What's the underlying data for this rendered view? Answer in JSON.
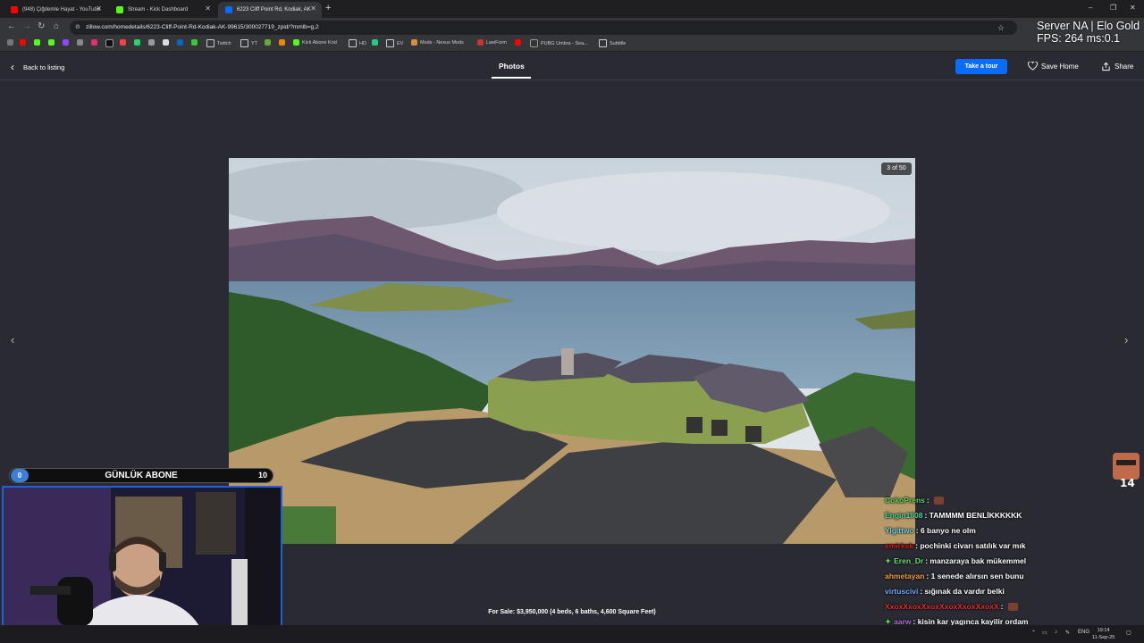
{
  "browser": {
    "tabs": [
      {
        "label": "(948) Çiğdemle Hayat - YouTube",
        "color": "#ff0000"
      },
      {
        "label": "Stream - Kick Dashboard",
        "color": "#53fc18"
      },
      {
        "label": "6223 Cliff Point Rd, Kodiak, AK",
        "color": "#0a6cff"
      }
    ],
    "url": "zillow.com/homedetails/6223-Cliff-Point-Rd-Kodiak-AK-99615/300027719_zpid/?mmlb=g,2",
    "bookmarks": [
      "Twitch",
      "YT",
      "Kick Abone Kod",
      "HD",
      "EV",
      "Mods - Nexus Mods",
      "LawForm",
      "PUBG Umbra - Sea...",
      "Subtitle"
    ]
  },
  "overlay": {
    "server": "Server NA | Elo Gold",
    "fps": "FPS: 264 ms:0.1"
  },
  "zillow": {
    "back_label": "Back to listing",
    "photos_tab": "Photos",
    "tour_label": "Take a tour",
    "save_label": "Save Home",
    "share_label": "Share",
    "photo_counter": "3 of 50",
    "caption": "For Sale: $3,950,000 (4 beds, 6 baths, 4,600 Square Feet)"
  },
  "stream": {
    "sub_goal": {
      "label": "GÜNLÜK ABONE",
      "current": "0",
      "target": "10"
    },
    "chat": [
      {
        "user": "CokoPrens",
        "color": "#5fd860",
        "text": "",
        "emote": true,
        "badge": false
      },
      {
        "user": "Engin1808",
        "color": "#4fd89a",
        "text": "TAMMMM BENLİKKKKKK",
        "emote": false,
        "badge": false
      },
      {
        "user": "Yigittwo",
        "color": "#70d8e8",
        "text": "6 banyo ne olm",
        "emote": false,
        "badge": false
      },
      {
        "user": "emirksk",
        "color": "#d02020",
        "text": "pochinki civarı satılık var mık",
        "emote": false,
        "badge": false
      },
      {
        "user": "Eren_Dr",
        "color": "#70e070",
        "text": "manzaraya bak mükemmel",
        "emote": false,
        "badge": true
      },
      {
        "user": "ahmetayan",
        "color": "#f0a040",
        "text": "1 senede alırsın sen bunu",
        "emote": false,
        "badge": false
      },
      {
        "user": "virtuscivi",
        "color": "#7aa8ff",
        "text": "sığınak da vardır belki",
        "emote": false,
        "badge": false
      },
      {
        "user": "XxoxXxoxXxoxXxoxXxoxXxoxX",
        "color": "#e03030",
        "text": "",
        "emote": true,
        "badge": false
      },
      {
        "user": "aarw",
        "color": "#b070e0",
        "text": "kisin kar yagınca kayilir ordam",
        "emote": false,
        "badge": true
      }
    ]
  },
  "taskbar": {
    "lang": "ENG",
    "time": "19:14",
    "date": "11-Sep-25"
  }
}
